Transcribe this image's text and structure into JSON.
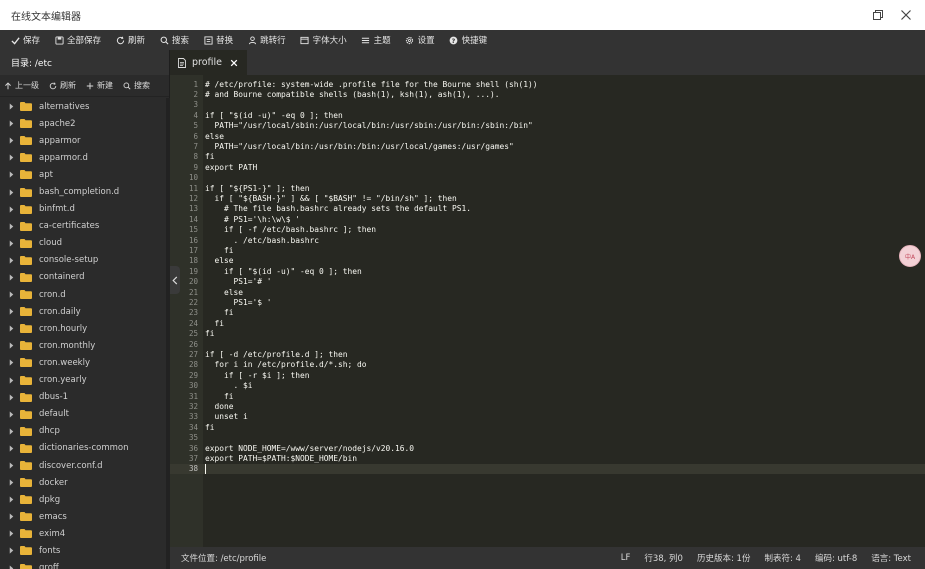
{
  "app": {
    "title": "在线文本编辑器"
  },
  "toolbar": {
    "items": [
      {
        "label": "保存",
        "icon": "check-icon"
      },
      {
        "label": "全部保存",
        "icon": "save-all-icon"
      },
      {
        "label": "刷新",
        "icon": "refresh-icon"
      },
      {
        "label": "搜索",
        "icon": "search-icon"
      },
      {
        "label": "替换",
        "icon": "replace-icon"
      },
      {
        "label": "跳转行",
        "icon": "goto-line-icon"
      },
      {
        "label": "字体大小",
        "icon": "font-size-icon"
      },
      {
        "label": "主题",
        "icon": "theme-icon"
      },
      {
        "label": "设置",
        "icon": "gear-icon"
      },
      {
        "label": "快捷键",
        "icon": "help-icon"
      }
    ]
  },
  "sidebar": {
    "dir_label": "目录: /etc",
    "tools": [
      {
        "label": "上一级",
        "icon": "arrow-up-icon"
      },
      {
        "label": "刷新",
        "icon": "refresh-icon"
      },
      {
        "label": "新建",
        "icon": "plus-icon"
      },
      {
        "label": "搜索",
        "icon": "search-icon"
      }
    ],
    "files": [
      "alternatives",
      "apache2",
      "apparmor",
      "apparmor.d",
      "apt",
      "bash_completion.d",
      "binfmt.d",
      "ca-certificates",
      "cloud",
      "console-setup",
      "containerd",
      "cron.d",
      "cron.daily",
      "cron.hourly",
      "cron.monthly",
      "cron.weekly",
      "cron.yearly",
      "dbus-1",
      "default",
      "dhcp",
      "dictionaries-common",
      "discover.conf.d",
      "docker",
      "dpkg",
      "emacs",
      "exim4",
      "fonts",
      "groff"
    ]
  },
  "editor": {
    "tab_label": "profile",
    "active_line": 38,
    "lines": [
      "# /etc/profile: system-wide .profile file for the Bourne shell (sh(1))",
      "# and Bourne compatible shells (bash(1), ksh(1), ash(1), ...).",
      "",
      "if [ \"$(id -u)\" -eq 0 ]; then",
      "  PATH=\"/usr/local/sbin:/usr/local/bin:/usr/sbin:/usr/bin:/sbin:/bin\"",
      "else",
      "  PATH=\"/usr/local/bin:/usr/bin:/bin:/usr/local/games:/usr/games\"",
      "fi",
      "export PATH",
      "",
      "if [ \"${PS1-}\" ]; then",
      "  if [ \"${BASH-}\" ] && [ \"$BASH\" != \"/bin/sh\" ]; then",
      "    # The file bash.bashrc already sets the default PS1.",
      "    # PS1='\\h:\\w\\$ '",
      "    if [ -f /etc/bash.bashrc ]; then",
      "      . /etc/bash.bashrc",
      "    fi",
      "  else",
      "    if [ \"$(id -u)\" -eq 0 ]; then",
      "      PS1='# '",
      "    else",
      "      PS1='$ '",
      "    fi",
      "  fi",
      "fi",
      "",
      "if [ -d /etc/profile.d ]; then",
      "  for i in /etc/profile.d/*.sh; do",
      "    if [ -r $i ]; then",
      "      . $i",
      "    fi",
      "  done",
      "  unset i",
      "fi",
      "",
      "export NODE_HOME=/www/server/nodejs/v20.16.0",
      "export PATH=$PATH:$NODE_HOME/bin",
      ""
    ]
  },
  "floating_button": {
    "label": "中A"
  },
  "statusbar": {
    "file_position": "文件位置: /etc/profile",
    "line_ending": "LF",
    "cursor_pos": "行38, 列0",
    "history": "历史版本: 1份",
    "tab_size": "制表符: 4",
    "encoding": "编码: utf-8",
    "language": "语言: Text"
  },
  "colors": {
    "toolbar_bg": "#333333",
    "sidebar_bg": "#2b2b2b",
    "editor_bg": "#272822",
    "folder": "#e8b339"
  }
}
